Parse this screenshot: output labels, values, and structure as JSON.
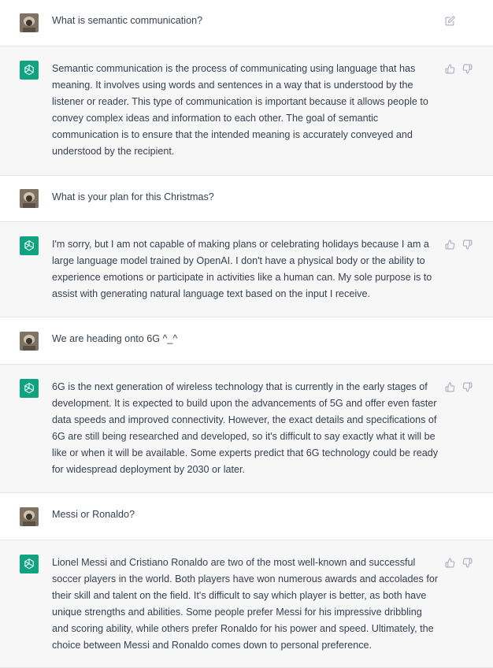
{
  "messages": [
    {
      "role": "user",
      "text": "What is semantic communication?"
    },
    {
      "role": "assistant",
      "text": "Semantic communication is the process of communicating using language that has meaning. It involves using words and sentences in a way that is understood by the listener or reader. This type of communication is important because it allows people to convey complex ideas and information to each other. The goal of semantic communication is to ensure that the intended meaning is accurately conveyed and understood by the recipient."
    },
    {
      "role": "user",
      "text": "What is your plan for this Christmas?"
    },
    {
      "role": "assistant",
      "text": "I'm sorry, but I am not capable of making plans or celebrating holidays because I am a large language model trained by OpenAI. I don't have a physical body or the ability to experience emotions or participate in activities like a human can. My sole purpose is to assist with generating natural language text based on the input I receive."
    },
    {
      "role": "user",
      "text": "We are heading onto 6G ^_^"
    },
    {
      "role": "assistant",
      "text": "6G is the next generation of wireless technology that is currently in the early stages of development. It is expected to build upon the advancements of 5G and offer even faster data speeds and improved connectivity. However, the exact details and specifications of 6G are still being researched and developed, so it's difficult to say exactly what it will be like or when it will be available. Some experts predict that 6G technology could be ready for widespread deployment by 2030 or later."
    },
    {
      "role": "user",
      "text": "Messi or Ronaldo?"
    },
    {
      "role": "assistant",
      "text": "Lionel Messi and Cristiano Ronaldo are two of the most well-known and successful soccer players in the world. Both players have won numerous awards and accolades for their skill and talent on the field. It's difficult to say which player is better, as both have unique strengths and abilities. Some people prefer Messi for his impressive dribbling and scoring ability, while others prefer Ronaldo for his power and speed. Ultimately, the choice between Messi and Ronaldo comes down to personal preference."
    }
  ],
  "icons": {
    "user_avatar": "user-avatar-photo",
    "assistant_avatar": "openai-logo-icon",
    "edit": "edit-icon",
    "thumbs_up": "thumbs-up-icon",
    "thumbs_down": "thumbs-down-icon"
  },
  "colors": {
    "user_bg": "#ffffff",
    "assistant_bg": "#f7f7f8",
    "assistant_accent": "#10a37f",
    "text": "#374151",
    "icon": "#acacbe",
    "divider": "#e3e4e8"
  }
}
